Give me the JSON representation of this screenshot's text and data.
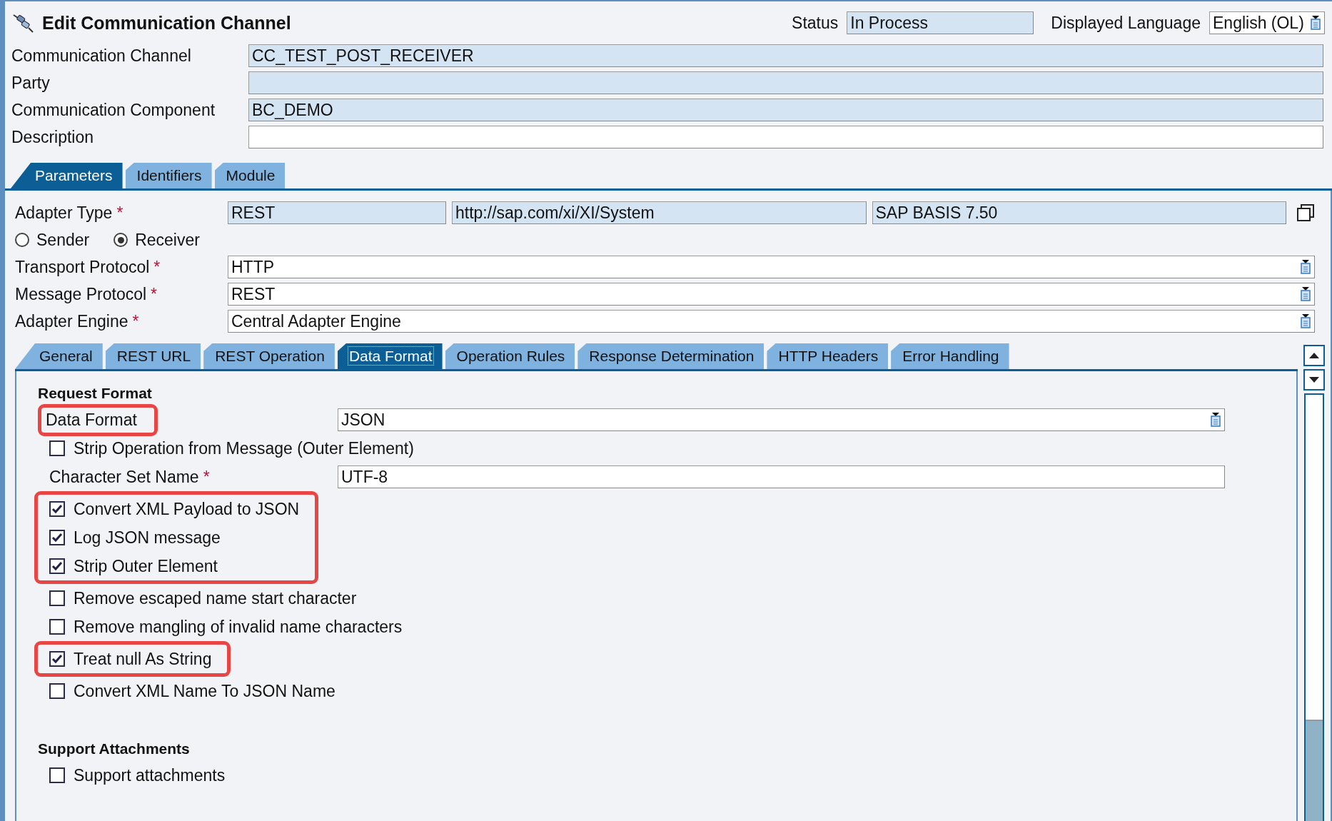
{
  "window": {
    "title": "Edit Communication Channel"
  },
  "status": {
    "label": "Status",
    "value": "In Process"
  },
  "language": {
    "label": "Displayed Language",
    "value": "English (OL)"
  },
  "header_fields": [
    {
      "label": "Communication Channel",
      "value": "CC_TEST_POST_RECEIVER",
      "editable": false
    },
    {
      "label": "Party",
      "editable": false
    },
    {
      "label": "Communication Component",
      "value": "BC_DEMO",
      "editable": false
    },
    {
      "label": "Description",
      "editable": true
    }
  ],
  "tabs": [
    {
      "label": "Parameters",
      "selected": true
    },
    {
      "label": "Identifiers",
      "selected": false
    },
    {
      "label": "Module",
      "selected": false
    }
  ],
  "adapter_type": {
    "label": "Adapter Type",
    "required_mark": "*",
    "values": [
      "REST",
      "http://sap.com/xi/XI/System",
      "SAP BASIS 7.50"
    ]
  },
  "direction": [
    {
      "label": "Sender",
      "selected": false
    },
    {
      "label": "Receiver",
      "selected": true
    }
  ],
  "protocol_fields": [
    {
      "label": "Transport Protocol",
      "required_mark": "*",
      "value": "HTTP"
    },
    {
      "label": "Message Protocol",
      "required_mark": "*",
      "value": "REST"
    },
    {
      "label": "Adapter Engine",
      "required_mark": "*",
      "value": "Central Adapter Engine"
    }
  ],
  "sub_tabs": [
    {
      "label": "General",
      "selected": false
    },
    {
      "label": "REST URL",
      "selected": false
    },
    {
      "label": "REST Operation",
      "selected": false
    },
    {
      "label": "Data Format",
      "selected": true
    },
    {
      "label": "Operation Rules",
      "selected": false
    },
    {
      "label": "Response Determination",
      "selected": false
    },
    {
      "label": "HTTP Headers",
      "selected": false
    },
    {
      "label": "Error Handling",
      "selected": false
    }
  ],
  "sections": [
    {
      "title": "Request Format",
      "rows": [
        {
          "kind": "dropdown",
          "label": "Data Format",
          "value": "JSON",
          "highlighted": true
        },
        {
          "kind": "checkbox",
          "label": "Strip Operation from Message (Outer Element)",
          "checked": false,
          "highlighted": false
        },
        {
          "kind": "text",
          "label": "Character Set Name",
          "required_mark": "*",
          "value": "UTF-8",
          "highlighted": false
        },
        {
          "kind": "checkbox",
          "label": "Convert XML Payload to JSON",
          "checked": true,
          "highlighted": true
        },
        {
          "kind": "checkbox",
          "label": "Log JSON message",
          "checked": true,
          "highlighted": true
        },
        {
          "kind": "checkbox",
          "label": "Strip Outer Element",
          "checked": true,
          "highlighted": true
        },
        {
          "kind": "checkbox",
          "label": "Remove escaped name start character",
          "checked": false,
          "highlighted": false
        },
        {
          "kind": "checkbox",
          "label": "Remove mangling of invalid name characters",
          "checked": false,
          "highlighted": false
        },
        {
          "kind": "checkbox",
          "label": "Treat null As String",
          "checked": true,
          "highlighted": true
        },
        {
          "kind": "checkbox",
          "label": "Convert XML Name To JSON Name",
          "checked": false,
          "highlighted": false
        }
      ]
    },
    {
      "title": "Support Attachments",
      "rows": [
        {
          "kind": "checkbox",
          "label": "Support attachments",
          "checked": false,
          "highlighted": false
        }
      ]
    }
  ]
}
